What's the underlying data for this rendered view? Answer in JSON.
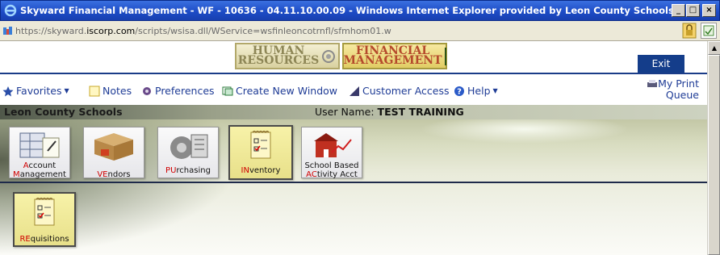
{
  "window": {
    "title": "Skyward Financial Management - WF - 10636 - 04.11.10.00.09 - Windows Internet Explorer provided by Leon County Schools",
    "minimize": "_",
    "maximize": "□",
    "close": "×"
  },
  "address": {
    "prefix": "https://skyward.",
    "host": "iscorp.com",
    "path": "/scripts/wsisa.dll/WService=wsfinleoncotrnfl/sfmhom01.w"
  },
  "modules": {
    "hr_line1": "HUMAN",
    "hr_line2": "RESOURCES",
    "fm_line1": "FINANCIAL",
    "fm_line2": "MANAGEMENT"
  },
  "exit_label": "Exit",
  "toolbar": {
    "favorites": "Favorites",
    "notes": "Notes",
    "preferences": "Preferences",
    "create_window": "Create New Window",
    "customer_access": "Customer Access",
    "help": "Help",
    "my_print_line1": "My Print",
    "my_print_line2": "Queue"
  },
  "school_bar": {
    "school": "Leon County Schools",
    "user_label": "User Name:",
    "user_value": "TEST TRAINING"
  },
  "tiles": [
    {
      "key": "A",
      "rest": "ccount",
      "line2_key": "M",
      "line2_rest": "anagement"
    },
    {
      "key": "VE",
      "rest": "ndors"
    },
    {
      "key": "PU",
      "rest": "rchasing"
    },
    {
      "key": "IN",
      "rest": "ventory"
    },
    {
      "line1": "School Based",
      "key": "AC",
      "rest": "tivity Acct"
    },
    {
      "key": "RE",
      "rest": "quisitions"
    }
  ],
  "colors": {
    "accent": "#1a3c88",
    "link": "#1f3c96",
    "hotkey": "#d00000",
    "active_tile": "#f7f2a8"
  }
}
